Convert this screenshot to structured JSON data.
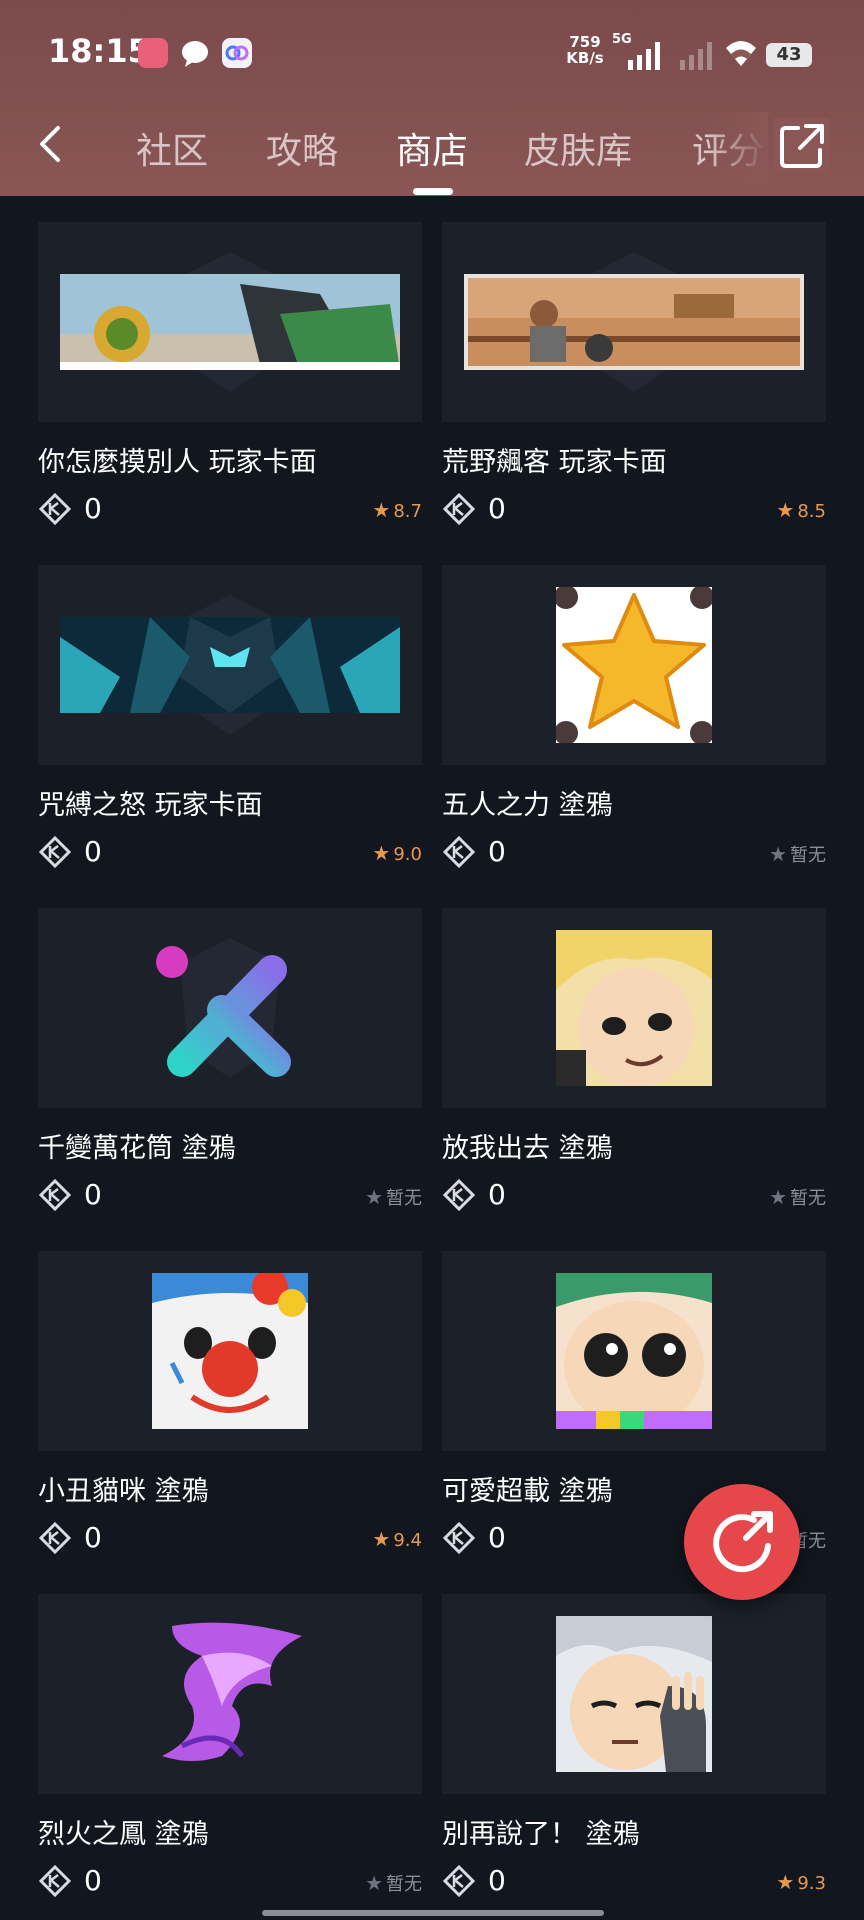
{
  "status_bar": {
    "time": "18:15",
    "net_speed_value": "759",
    "net_speed_unit": "KB/s",
    "network_type": "5G",
    "battery": "43"
  },
  "nav": {
    "tabs": [
      {
        "label": "社区"
      },
      {
        "label": "攻略"
      },
      {
        "label": "商店"
      },
      {
        "label": "皮肤库"
      },
      {
        "label": "评分"
      }
    ],
    "active_tab": "商店"
  },
  "items": [
    {
      "title": "你怎麼摸別人 玩家卡面",
      "price": "0",
      "rating": "8.7"
    },
    {
      "title": "荒野飆客 玩家卡面",
      "price": "0",
      "rating": "8.5"
    },
    {
      "title": "咒縛之怒 玩家卡面",
      "price": "0",
      "rating": "9.0"
    },
    {
      "title": "五人之力 塗鴉",
      "price": "0",
      "rating": "暂无"
    },
    {
      "title": "千變萬花筒 塗鴉",
      "price": "0",
      "rating": "暂无"
    },
    {
      "title": "放我出去 塗鴉",
      "price": "0",
      "rating": "暂无"
    },
    {
      "title": "小丑貓咪 塗鴉",
      "price": "0",
      "rating": "9.4"
    },
    {
      "title": "可愛超載 塗鴉",
      "price": "0",
      "rating": "暂无"
    },
    {
      "title": "烈火之鳳 塗鴉",
      "price": "0",
      "rating": "暂无"
    },
    {
      "title": "別再說了！ 塗鴉",
      "price": "0",
      "rating": "9.3"
    }
  ],
  "colors": {
    "header_bg": "#8a5656",
    "page_bg": "#12161e",
    "card_bg": "#1c2029",
    "rating_color": "#e79a4f",
    "fab_color": "#e6474a"
  }
}
